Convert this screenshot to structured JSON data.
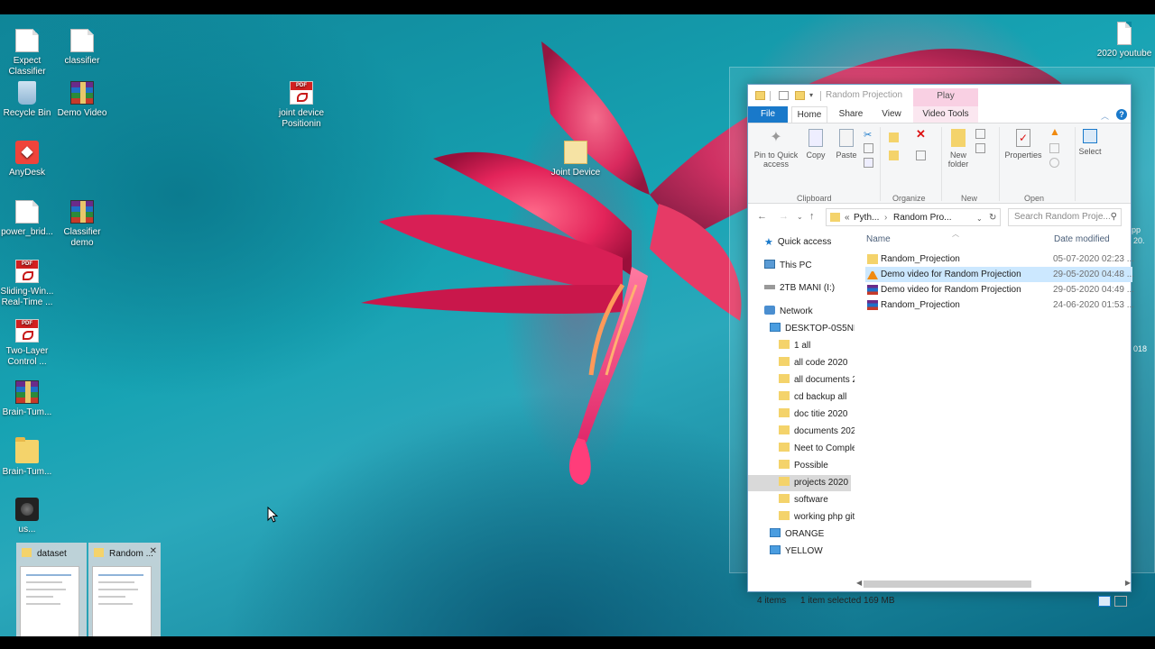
{
  "desktop": {
    "icons": [
      {
        "label": "Expect Classifier",
        "icon": "document-icon"
      },
      {
        "label": "classifier",
        "icon": "document-icon"
      },
      {
        "label": "Recycle Bin",
        "icon": "recycle-bin-icon"
      },
      {
        "label": "Demo Video",
        "icon": "rar-archive-icon"
      },
      {
        "label": "joint device Positionin",
        "icon": "pdf-icon"
      },
      {
        "label": "AnyDesk",
        "icon": "anydesk-icon"
      },
      {
        "label": "Joint Device",
        "icon": "folder-document-icon"
      },
      {
        "label": "power_brid...",
        "icon": "document-icon"
      },
      {
        "label": "Classifier demo",
        "icon": "rar-archive-icon"
      },
      {
        "label": "Sliding-Win... Real-Time ...",
        "icon": "pdf-icon"
      },
      {
        "label": "Two-Layer Control ...",
        "icon": "pdf-icon"
      },
      {
        "label": "Brain-Tum...",
        "icon": "rar-archive-icon"
      },
      {
        "label": "Brain-Tum...",
        "icon": "folder-icon"
      },
      {
        "label": "us...",
        "icon": "video-icon"
      },
      {
        "label": "2020 youtube",
        "icon": "document-icon"
      }
    ],
    "ghost_fragments": [
      "pp",
      "20.",
      "018"
    ]
  },
  "explorer": {
    "title": "Random Projection",
    "contextual_tab": "Play",
    "tabs": [
      "File",
      "Home",
      "Share",
      "View",
      "Video Tools"
    ],
    "ribbon": {
      "pin_label": "Pin to Quick access",
      "copy_label": "Copy",
      "paste_label": "Paste",
      "clipboard_group": "Clipboard",
      "organize_group": "Organize",
      "new_folder_label": "New folder",
      "new_group": "New",
      "properties_label": "Properties",
      "open_group": "Open",
      "select_label": "Select"
    },
    "address": {
      "crumbs": [
        "Pyth...",
        "Random Pro..."
      ],
      "search_placeholder": "Search Random Proje..."
    },
    "nav": {
      "quick_access": "Quick access",
      "this_pc": "This PC",
      "drive": "2TB MANI (I:)",
      "network": "Network",
      "computer": "DESKTOP-0S5NPI",
      "folders": [
        "1 all",
        "all code 2020",
        "all documents 2",
        "cd backup all",
        "doc titie 2020",
        "documents 202",
        "Neet to Comple",
        "Possible",
        "projects  2020",
        "software",
        "working php git"
      ],
      "selected_folder": "projects  2020",
      "extra": [
        "ORANGE",
        "YELLOW"
      ]
    },
    "columns": {
      "name": "Name",
      "date": "Date modified"
    },
    "files": [
      {
        "name": "Random_Projection",
        "date": "05-07-2020 02:23 ...",
        "icon": "folder-icon"
      },
      {
        "name": "Demo video for Random Projection",
        "date": "29-05-2020 04:48 ...",
        "icon": "vlc-icon",
        "selected": true
      },
      {
        "name": "Demo video for Random Projection",
        "date": "29-05-2020 04:49 ...",
        "icon": "rar-archive-icon"
      },
      {
        "name": "Random_Projection",
        "date": "24-06-2020 01:53 ...",
        "icon": "rar-archive-icon"
      }
    ],
    "status": {
      "items": "4 items",
      "selection": "1 item selected  169 MB"
    }
  },
  "taskbar_previews": [
    {
      "title": "dataset"
    },
    {
      "title": "Random ..."
    }
  ]
}
